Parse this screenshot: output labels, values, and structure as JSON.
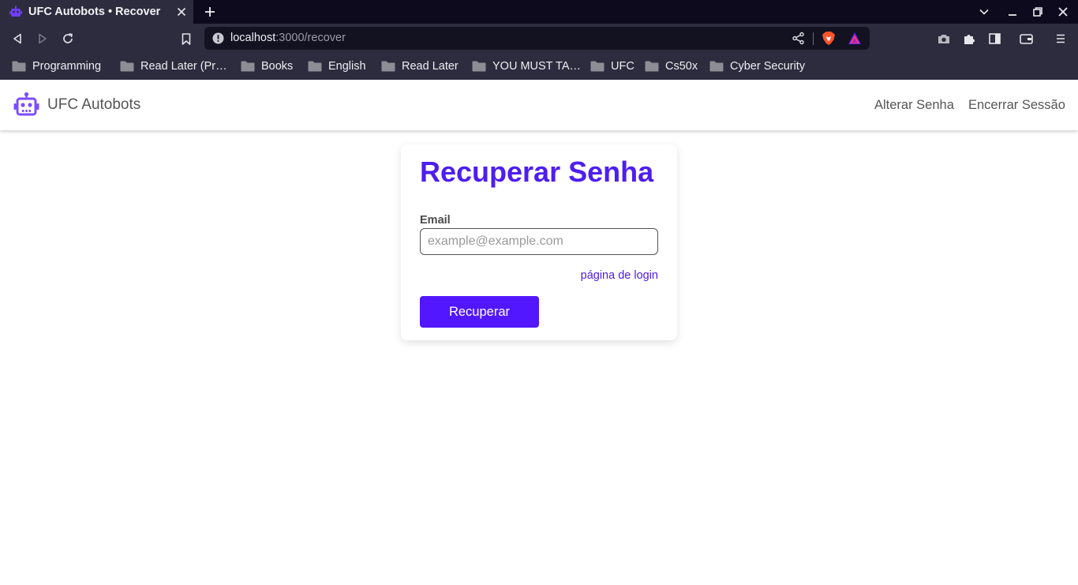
{
  "browser": {
    "tab_title": "UFC Autobots • Recover",
    "url_host": "localhost",
    "url_path": ":3000/recover",
    "bookmarks": [
      "Programming",
      "Read Later (Pr…",
      "Books",
      "English",
      "Read Later",
      "YOU MUST TA…",
      "UFC",
      "Cs50x",
      "Cyber Security"
    ],
    "icons": {
      "back": "back-icon",
      "forward": "forward-icon",
      "reload": "reload-icon",
      "bookmark": "bookmark-icon",
      "site_info": "info-icon",
      "share": "share-icon",
      "brave_shields": "brave-lion-icon",
      "rewards": "rewards-triangle-icon",
      "screenshot": "camera-icon",
      "extensions": "puzzle-icon",
      "sidebar": "sidebar-icon",
      "wallet": "wallet-icon",
      "menu": "hamburger-menu-icon"
    }
  },
  "navbar": {
    "brand": "UFC Autobots",
    "links": [
      "Alterar Senha",
      "Encerrar Sessão"
    ]
  },
  "recover_form": {
    "title": "Recuperar Senha",
    "email_label": "Email",
    "email_placeholder": "example@example.com",
    "email_value": "",
    "login_link": "página de login",
    "submit_label": "Recuperar"
  },
  "colors": {
    "accent": "#4e1df0",
    "button": "#5217ff",
    "chrome_bg": "#2d2c3e",
    "tabbar_bg": "#0c0a1c"
  }
}
